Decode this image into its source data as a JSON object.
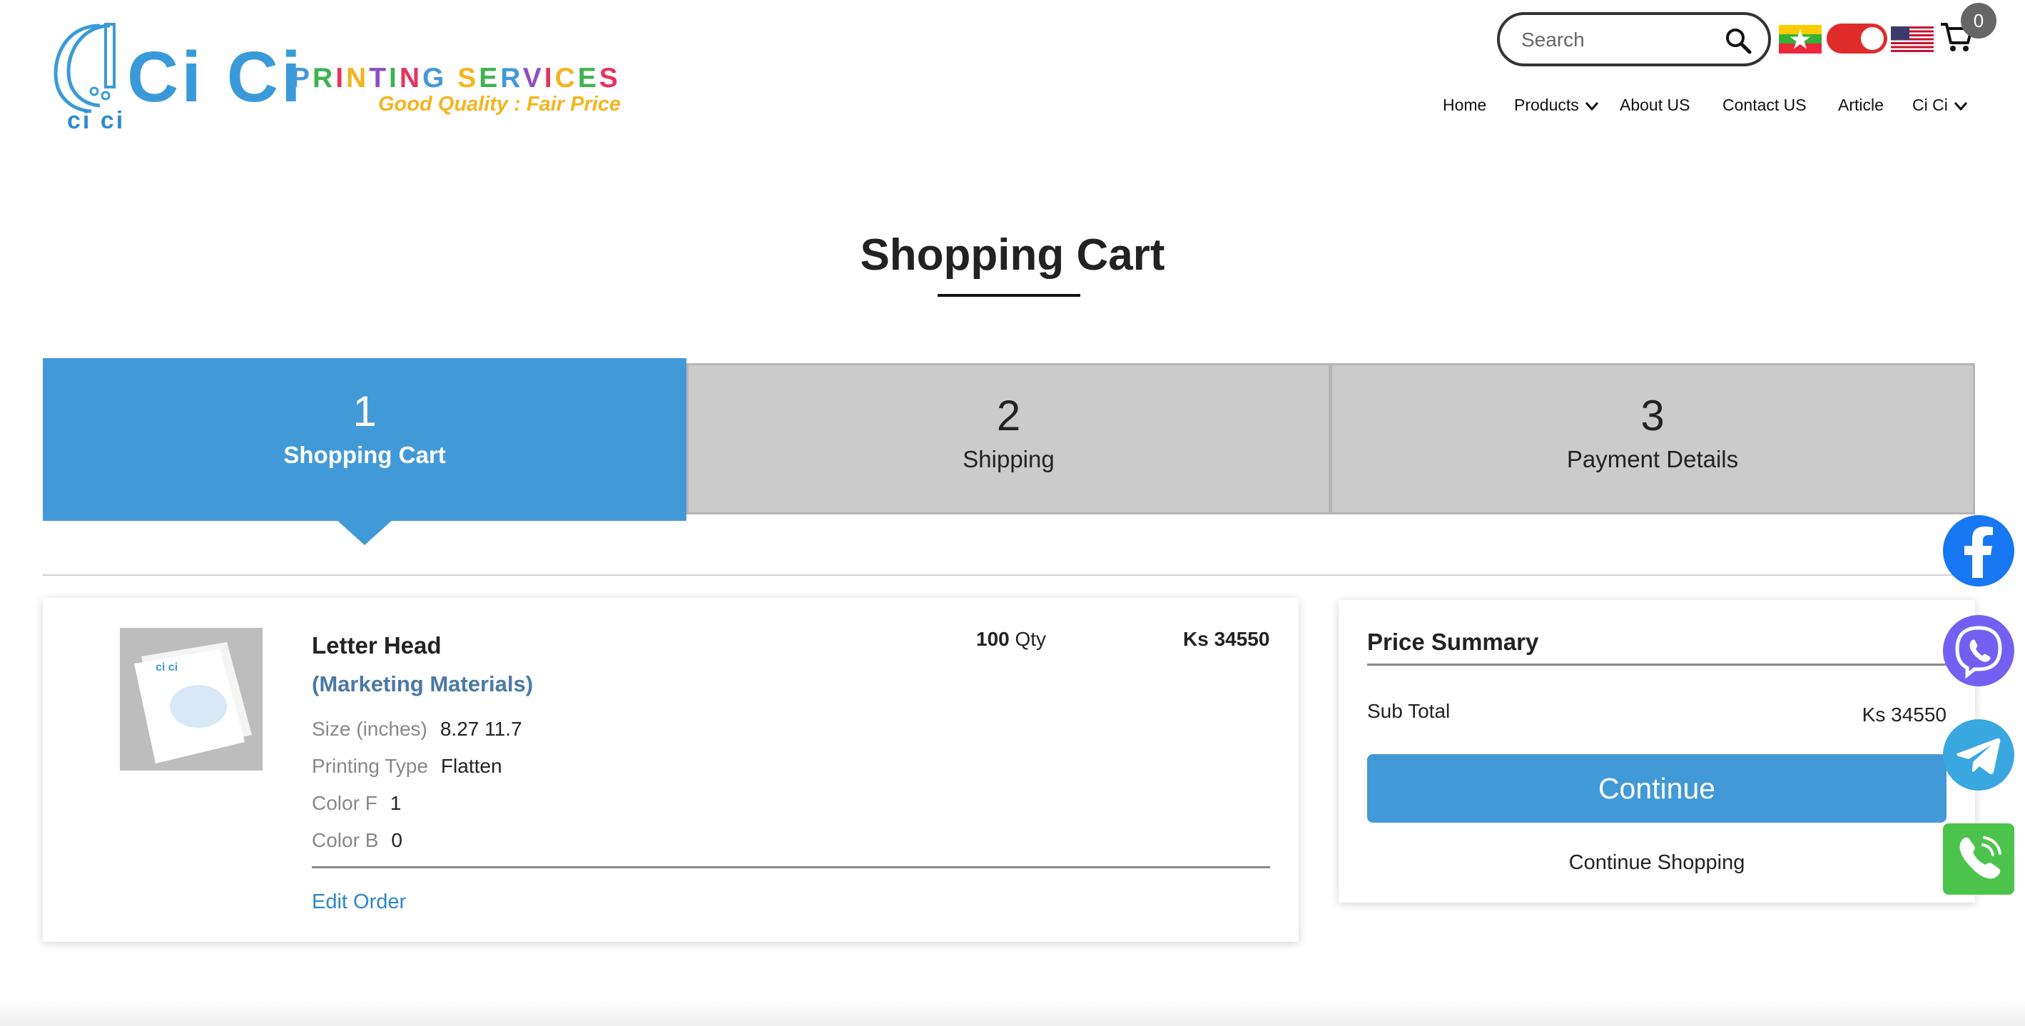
{
  "header": {
    "logo": {
      "mark_text": "ci ci",
      "brand": "Ci Ci",
      "printing_services": [
        "P",
        "R",
        "I",
        "N",
        "T",
        "I",
        "N",
        "G",
        " ",
        "S",
        "E",
        "R",
        "V",
        "I",
        "C",
        "E",
        "S"
      ],
      "printing_colors": [
        "#4299d8",
        "#3fb24f",
        "#e5345d",
        "#f3b41f",
        "#8e4fc1",
        "#3fb24f",
        "#e5345d",
        "#4299d8",
        "#ffffff",
        "#f3b41f",
        "#3fb24f",
        "#4299d8",
        "#8e4fc1",
        "#e5345d",
        "#f3b41f",
        "#3fb24f",
        "#e5345d"
      ],
      "tagline": "Good Quality : Fair Price"
    },
    "search": {
      "placeholder": "Search",
      "value": ""
    },
    "cart_count": "0",
    "nav": {
      "home": "Home",
      "products": "Products",
      "about": "About US",
      "contact": "Contact US",
      "article": "Article",
      "cici": "Ci Ci"
    }
  },
  "page_title": "Shopping Cart",
  "steps": [
    {
      "number": "1",
      "label": "Shopping Cart",
      "active": true
    },
    {
      "number": "2",
      "label": "Shipping",
      "active": false
    },
    {
      "number": "3",
      "label": "Payment Details",
      "active": false
    }
  ],
  "cart_item": {
    "name": "Letter Head",
    "category": "(Marketing Materials)",
    "specs": [
      {
        "key": "Size (inches)",
        "value": "8.27 11.7"
      },
      {
        "key": "Printing Type",
        "value": "Flatten"
      },
      {
        "key": "Color F",
        "value": "1"
      },
      {
        "key": "Color B",
        "value": "0"
      }
    ],
    "qty_number": "100",
    "qty_unit": "Qty",
    "price": "Ks 34550",
    "edit_label": "Edit Order"
  },
  "summary": {
    "title": "Price Summary",
    "subtotal_label": "Sub Total",
    "subtotal_value": "Ks 34550",
    "continue_label": "Continue",
    "continue_shopping_label": "Continue Shopping"
  },
  "social_icons": [
    "facebook-icon",
    "viber-icon",
    "telegram-icon",
    "phone-icon"
  ],
  "colors": {
    "accent": "#4299d8",
    "step_inactive": "#cbcbcb",
    "link": "#2e86c9",
    "toggle": "#e02b2b"
  }
}
